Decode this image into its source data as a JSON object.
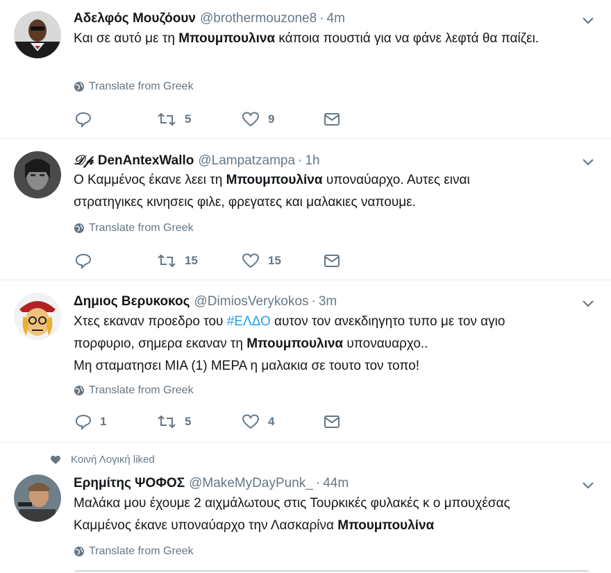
{
  "translate_label": "Translate from Greek",
  "tweets": [
    {
      "name": "Αδελφός Μουζόουν",
      "handle": "@brothermouzone8",
      "time": "4m",
      "text_parts": [
        "Και σε αυτό με τη ",
        "Μπουμπουλινα",
        " κάποια πουστιά για να φάνε λεφτά θα παίζει."
      ],
      "replies": "",
      "retweets": "5",
      "likes": "9"
    },
    {
      "name_prefix": "𝒟𝓅",
      "name": "DenAntexWallo",
      "handle": "@Lampatzampa",
      "time": "1h",
      "text_line1_parts": [
        "Ο Καμμένος έκανε λεει τη ",
        "Μπουμπουλίνα",
        " υποναύαρχο. Αυτες ειναι"
      ],
      "text_line2": "στρατηγικες κινησεις φιλε, φρεγατες και μαλακιες ναπουμε.",
      "replies": "",
      "retweets": "15",
      "likes": "15"
    },
    {
      "name": "Δημιος Βερυκοκος",
      "handle": "@DimiosVerykokos",
      "time": "3m",
      "text_line1_parts": [
        "Χτες εκαναν προεδρο του ",
        "#ΕΛΔΟ",
        " αυτον τον ανεκδιηγητο τυπο με τον αγιο"
      ],
      "text_line2_parts": [
        "πορφυριο, σημερα εκαναν τη ",
        "Μπουμπουλινα",
        " υποναυαρχο.."
      ],
      "text_line3": "Μη σταματησει ΜΙΑ (1) ΜΕΡΑ η μαλακια σε τουτο τον τοπο!",
      "replies": "1",
      "retweets": "5",
      "likes": "4"
    },
    {
      "liked_by": "Κοινή Λογική liked",
      "name": "Ερημίτης ΨΟΦΟΣ",
      "handle": "@MakeMyDayPunk_",
      "time": "44m",
      "text_line1": "Μαλάκα μου έχουμε 2 αιχμάλωτους στις Τουρκικές φυλακές κ ο μπουχέσας",
      "text_line2_parts": [
        "Καμμένος έκανε υποναύαρχο την Λασκαρίνα ",
        "Μπουμπουλίνα"
      ]
    }
  ],
  "colors": {
    "accent": "#1da1f2",
    "secondary_text": "#657786",
    "divider": "#e6ecf0"
  },
  "icons": [
    "reply-icon",
    "retweet-icon",
    "like-icon",
    "message-icon",
    "globe-icon",
    "chevron-down-icon",
    "heart-icon"
  ]
}
